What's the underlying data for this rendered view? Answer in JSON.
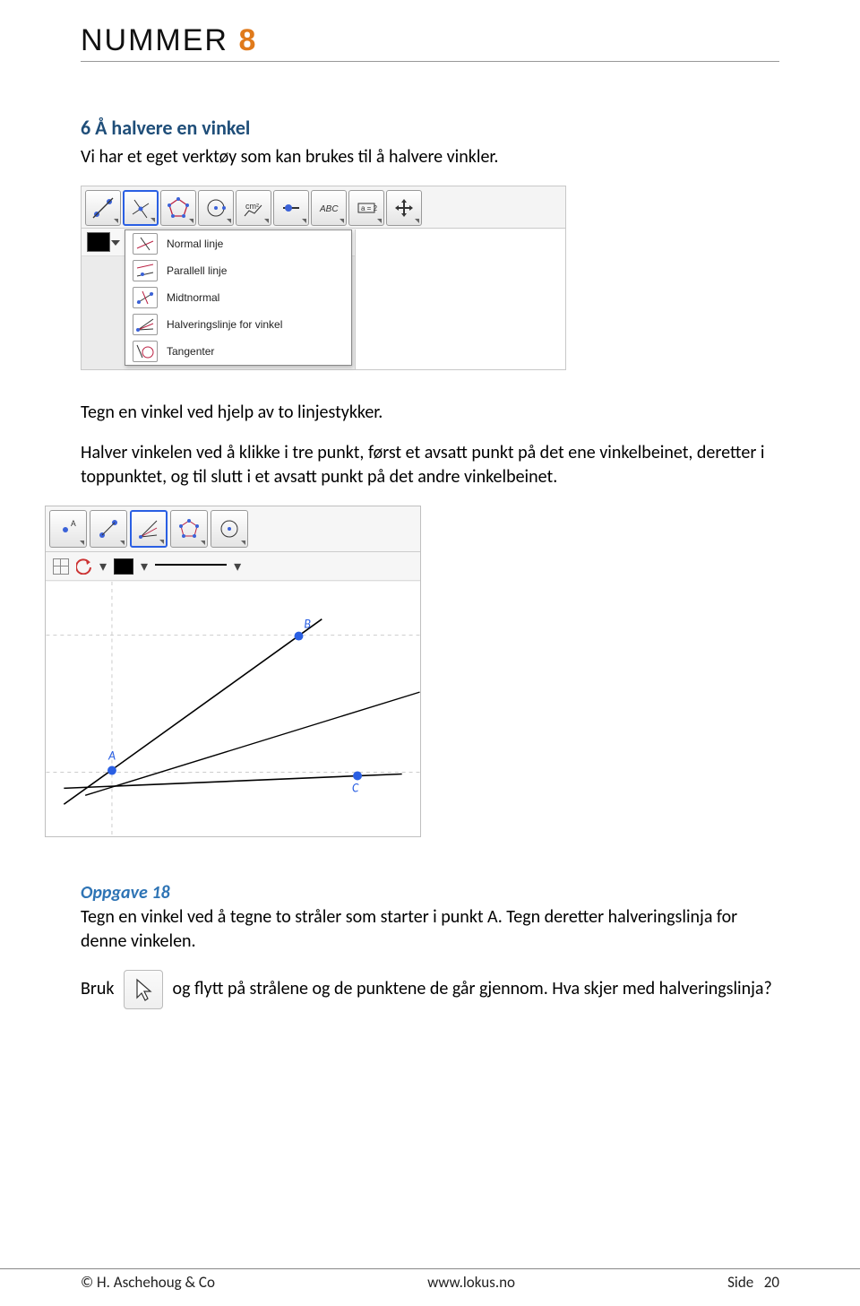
{
  "brand": {
    "logo_text": "NUMMER ",
    "logo_number": "8"
  },
  "section6": {
    "heading": "6 Å halvere en vinkel",
    "intro": "Vi har et eget verktøy som kan brukes til å halvere vinkler.",
    "after_shot1_a": "Tegn en vinkel ved hjelp av to linjestykker.",
    "after_shot1_b": "Halver vinkelen ved å klikke i tre punkt, først et avsatt punkt på det ene vinkelbeinet, deretter i toppunktet, og til slutt i et avsatt punkt på det andre vinkelbeinet."
  },
  "dropdown_menu": {
    "items": [
      {
        "label": "Normal linje"
      },
      {
        "label": "Parallell linje"
      },
      {
        "label": "Midtnormal"
      },
      {
        "label": "Halveringslinje for vinkel"
      },
      {
        "label": "Tangenter"
      }
    ]
  },
  "toolbar_icons_top": {
    "tool3_label": "cm²",
    "tool_abc": "ABC",
    "tool_eq": "a = 2"
  },
  "shot2_labels": {
    "A": "A",
    "B": "B",
    "C": "C"
  },
  "oppgave18": {
    "heading": "Oppgave 18",
    "p1": "Tegn en vinkel ved å tegne to stråler som starter i punkt A. Tegn deretter halveringslinja for denne vinkelen.",
    "p2_before": "Bruk",
    "p2_after": "og flytt på strålene og de punktene de går gjennom. Hva skjer med halveringslinja?"
  },
  "footer": {
    "left": "© H. Aschehoug & Co",
    "center": "www.lokus.no",
    "right_label": "Side",
    "page": "20"
  }
}
